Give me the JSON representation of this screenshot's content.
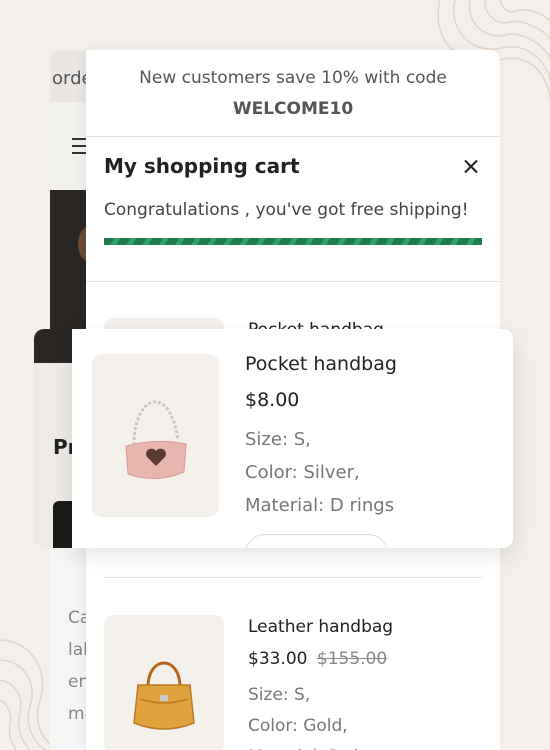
{
  "background": {
    "topbar_text": "orde",
    "body_text": [
      "Ca",
      "lab",
      "en",
      "ma"
    ],
    "window_heading": "Pr"
  },
  "announcement": {
    "text": "New customers save 10% with code",
    "code": "WELCOME10"
  },
  "cart": {
    "title": "My shopping cart",
    "free_shipping_message": "Congratulations , you've got free shipping!",
    "free_shipping_progress": 1.0,
    "items": [
      {
        "name": "Pocket handbag",
        "price": "$8.00",
        "options": [
          "Size: S,",
          "Color: Silver,",
          "Material: D rings"
        ],
        "image": "pink-heart-handbag"
      },
      {
        "name": "Leather handbag",
        "price": "$33.00",
        "compare_price": "$155.00",
        "options": [
          "Size: S,",
          "Color: Gold,",
          "Material: D rings"
        ],
        "image": "tan-leather-handbag"
      }
    ]
  },
  "colors": {
    "progress_green": "#1f7a4d",
    "background": "#f3efeb"
  }
}
